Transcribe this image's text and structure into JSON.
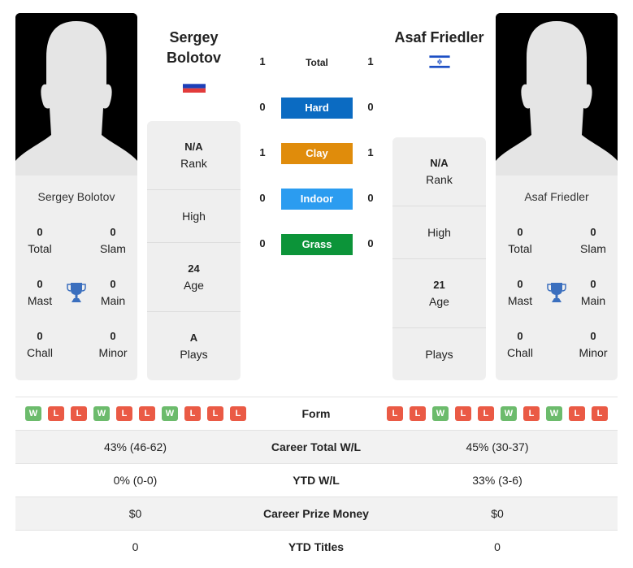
{
  "colors": {
    "hard": "#0b6bc2",
    "clay": "#e08c0b",
    "indoor": "#2b9cf0",
    "grass": "#0c9439",
    "win": "#6cbb6c",
    "loss": "#ea5a45",
    "trophy": "#3b6fbe"
  },
  "player1": {
    "header_name_line1": "Sergey",
    "header_name_line2": "Bolotov",
    "card_name": "Sergey Bolotov",
    "flag": "russia-flag",
    "titles": {
      "total": "0",
      "slam": "0",
      "mast": "0",
      "main": "0",
      "chall": "0",
      "minor": "0"
    },
    "info": {
      "rank": "N/A",
      "high": "",
      "age": "24",
      "plays": "A"
    },
    "form": [
      "W",
      "L",
      "L",
      "W",
      "L",
      "L",
      "W",
      "L",
      "L",
      "L"
    ]
  },
  "player2": {
    "header_name": "Asaf Friedler",
    "card_name": "Asaf Friedler",
    "flag": "israel-flag",
    "titles": {
      "total": "0",
      "slam": "0",
      "mast": "0",
      "main": "0",
      "chall": "0",
      "minor": "0"
    },
    "info": {
      "rank": "N/A",
      "high": "",
      "age": "21",
      "plays": ""
    },
    "form": [
      "L",
      "L",
      "W",
      "L",
      "L",
      "W",
      "L",
      "W",
      "L",
      "L"
    ]
  },
  "labels": {
    "total": "Total",
    "slam": "Slam",
    "mast": "Mast",
    "main": "Main",
    "chall": "Chall",
    "minor": "Minor",
    "rank": "Rank",
    "high": "High",
    "age": "Age",
    "plays": "Plays"
  },
  "h2h": {
    "total": {
      "label": "Total",
      "p1": "1",
      "p2": "1"
    },
    "hard": {
      "label": "Hard",
      "p1": "0",
      "p2": "0"
    },
    "clay": {
      "label": "Clay",
      "p1": "1",
      "p2": "1"
    },
    "indoor": {
      "label": "Indoor",
      "p1": "0",
      "p2": "0"
    },
    "grass": {
      "label": "Grass",
      "p1": "0",
      "p2": "0"
    }
  },
  "stats": {
    "form_label": "Form",
    "rows": [
      {
        "label": "Career Total W/L",
        "p1": "43% (46-62)",
        "p2": "45% (30-37)"
      },
      {
        "label": "YTD W/L",
        "p1": "0% (0-0)",
        "p2": "33% (3-6)"
      },
      {
        "label": "Career Prize Money",
        "p1": "$0",
        "p2": "$0"
      },
      {
        "label": "YTD Titles",
        "p1": "0",
        "p2": "0"
      }
    ]
  }
}
